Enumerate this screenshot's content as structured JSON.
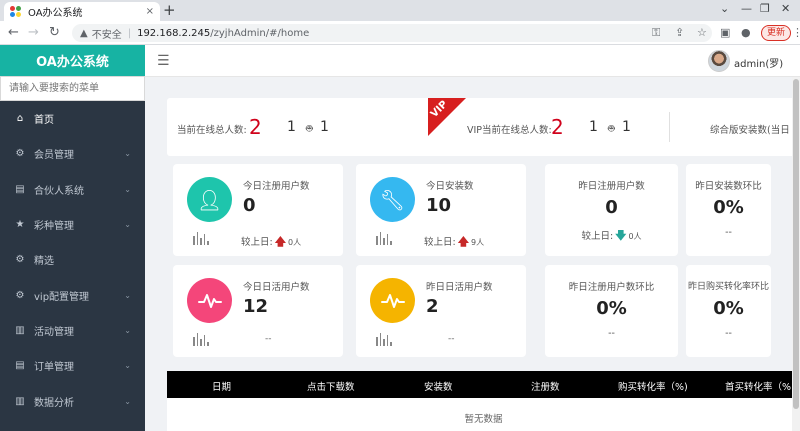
{
  "browser": {
    "tab_title": "OA办公系统",
    "tab_close": "×",
    "new_tab": "+",
    "insecure_label": "不安全",
    "url_separator": "|",
    "url_host": "192.168.2.245",
    "url_path": "/zyjhAdmin/#/home",
    "update_label": "更新"
  },
  "sidebar": {
    "brand": "OA办公系统",
    "search_placeholder": "请输入要搜索的菜单",
    "items": [
      {
        "label": "首页",
        "icon": "home-icon",
        "glyph": "⌂",
        "expandable": false,
        "active": true
      },
      {
        "label": "会员管理",
        "icon": "gear-icon",
        "glyph": "⚙",
        "expandable": true
      },
      {
        "label": "合伙人系统",
        "icon": "document-icon",
        "glyph": "▤",
        "expandable": true
      },
      {
        "label": "彩种管理",
        "icon": "star-icon",
        "glyph": "★",
        "expandable": true
      },
      {
        "label": "精选",
        "icon": "gear-icon",
        "glyph": "⚙",
        "expandable": false
      },
      {
        "label": "vip配置管理",
        "icon": "gear-icon",
        "glyph": "⚙",
        "expandable": true
      },
      {
        "label": "活动管理",
        "icon": "bar-chart-icon",
        "glyph": "▥",
        "expandable": true
      },
      {
        "label": "订单管理",
        "icon": "document-icon",
        "glyph": "▤",
        "expandable": true
      },
      {
        "label": "数据分析",
        "icon": "bar-chart-icon",
        "glyph": "▥",
        "expandable": true
      }
    ]
  },
  "header": {
    "user_name": "admin(罗)"
  },
  "online": {
    "total_label": "当前在线总人数:",
    "total_count": "2",
    "total_ios": "1",
    "total_android": "1",
    "vip_badge": "VIP",
    "vip_label": "VIP当前在线总人数:",
    "vip_count": "2",
    "vip_ios": "1",
    "vip_android": "1",
    "combined_label": "综合版安装数(当日"
  },
  "cards": {
    "today_register": {
      "title": "今日注册用户数",
      "value": "0",
      "compare_label": "较上日:",
      "compare_value": "0人",
      "color": "#1ec5ac"
    },
    "today_install": {
      "title": "今日安装数",
      "value": "10",
      "compare_label": "较上日:",
      "compare_value": "9人",
      "color": "#35b8f0"
    },
    "yesterday_register": {
      "title": "昨日注册用户数",
      "value": "0",
      "compare_label": "较上日:",
      "compare_value": "0人"
    },
    "yesterday_install_ratio": {
      "title": "昨日安装数环比",
      "value": "0%",
      "compare_value": "--"
    },
    "today_active": {
      "title": "今日日活用户数",
      "value": "12",
      "compare_value": "--",
      "color": "#f4467a"
    },
    "yesterday_active": {
      "title": "昨日日活用户数",
      "value": "2",
      "compare_value": "--",
      "color": "#f5b400"
    },
    "yesterday_register_ratio": {
      "title": "昨日注册用户数环比",
      "value": "0%",
      "compare_value": "--"
    },
    "yesterday_conversion_ratio": {
      "title": "昨日购买转化率环比",
      "value": "0%",
      "compare_value": "--"
    }
  },
  "table": {
    "columns": [
      "日期",
      "点击下载数",
      "安装数",
      "注册数",
      "购买转化率（%)",
      "首买转化率（%"
    ],
    "empty_text": "暂无数据"
  }
}
